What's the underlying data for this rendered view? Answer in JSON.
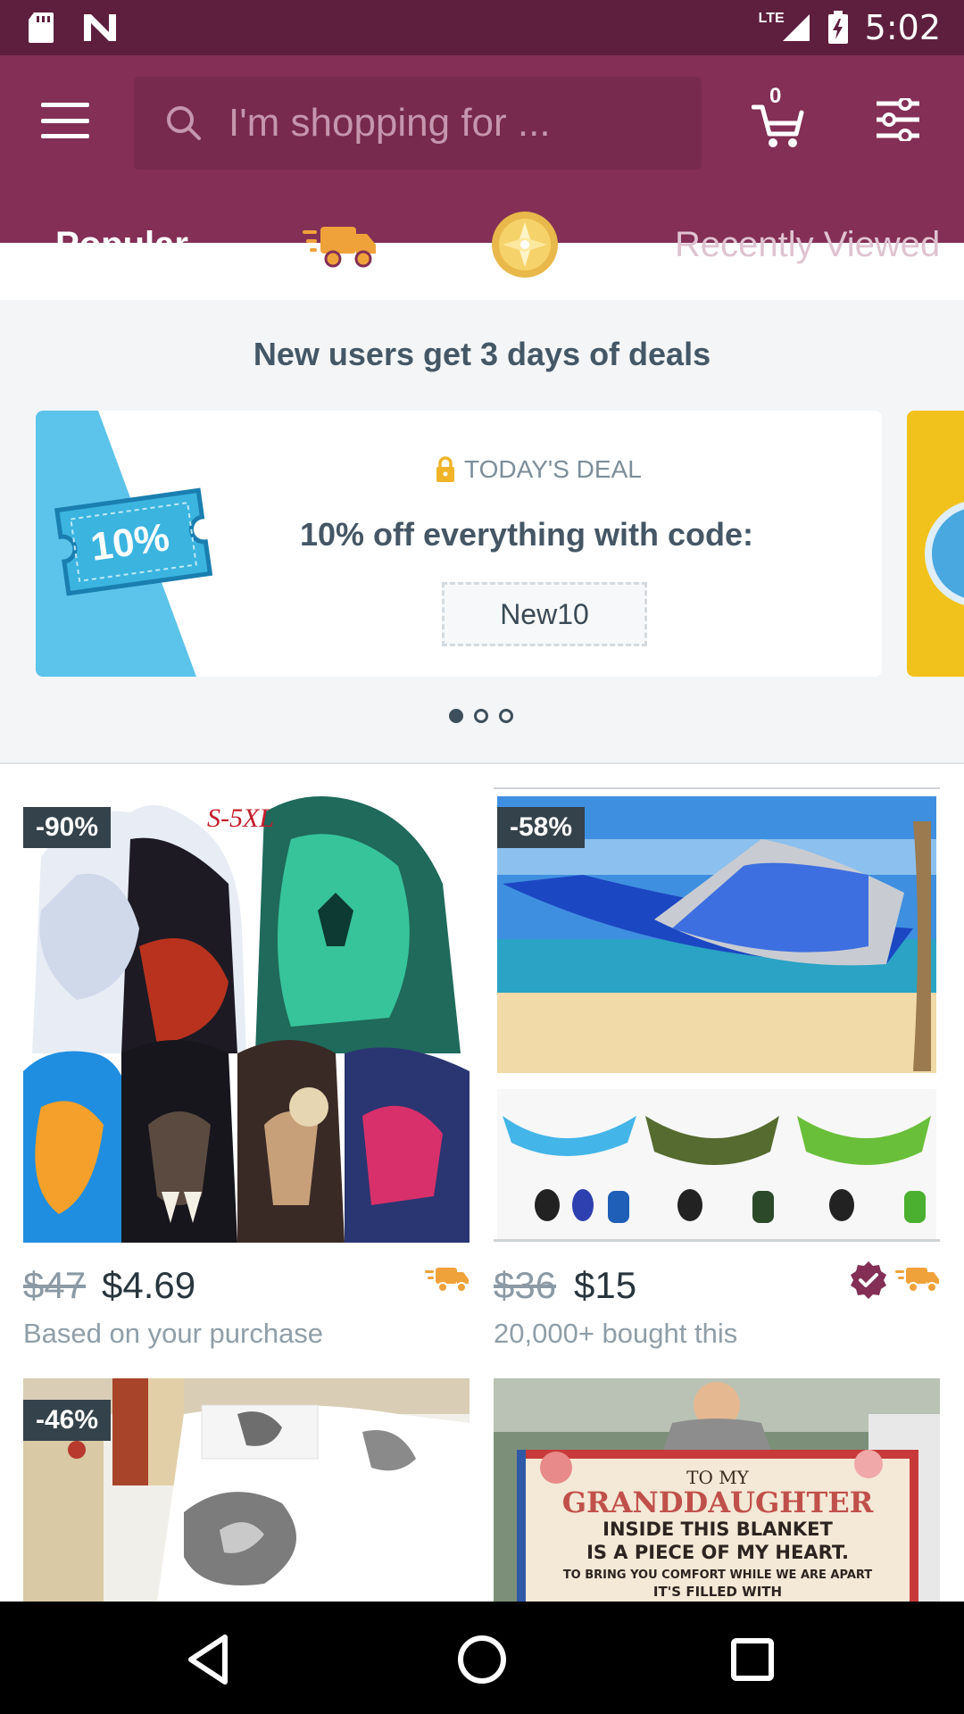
{
  "status_bar": {
    "time": "5:02",
    "network": "LTE",
    "icons": [
      "sd-card-icon",
      "n-logo-icon",
      "signal-icon",
      "battery-charging-icon"
    ]
  },
  "header": {
    "menu_icon": "hamburger-icon",
    "search": {
      "placeholder": "I'm shopping for ...",
      "value": "",
      "icon": "search-icon"
    },
    "cart": {
      "icon": "cart-icon",
      "count": "0"
    },
    "filter_icon": "sliders-icon"
  },
  "tabs": [
    {
      "label": "Popular",
      "active": true
    },
    {
      "label": "",
      "icon": "fast-shipping-icon"
    },
    {
      "label": "",
      "icon": "coin-icon"
    },
    {
      "label": "Recently Viewed"
    }
  ],
  "banner": {
    "title": "New users get 3 days of deals",
    "deal_label": "TODAY'S DEAL",
    "deal_text": "10% off everything with code:",
    "code": "New10",
    "coupon_text": "10%",
    "page_count": 3,
    "current_page": 1
  },
  "products": [
    {
      "discount": "-90%",
      "old_price": "$47",
      "price": "$4.69",
      "subtitle": "Based on your purchase",
      "badges": [
        "fast-shipping-icon"
      ],
      "image": "wolf-hoodies",
      "image_text": "S-5XL"
    },
    {
      "discount": "-58%",
      "old_price": "$36",
      "price": "$15",
      "subtitle": "20,000+ bought this",
      "badges": [
        "verified-icon",
        "fast-shipping-icon"
      ],
      "image": "hammocks"
    },
    {
      "discount": "-46%",
      "image": "wolf-bedding"
    },
    {
      "discount": "",
      "image": "granddaughter-blanket",
      "image_text": [
        "TO MY",
        "GRANDDAUGHTER",
        "INSIDE THIS BLANKET",
        "IS A PIECE OF MY HEART.",
        "TO BRING YOU COMFORT WHILE WE ARE APART",
        "IT'S FILLED WITH"
      ]
    }
  ],
  "nav": [
    "back-icon",
    "home-icon",
    "recents-icon"
  ],
  "colors": {
    "status_bar": "#5e1f3e",
    "app_bar": "#832f56",
    "accent_orange": "#f0a23a",
    "badge_dark": "#34424b"
  }
}
